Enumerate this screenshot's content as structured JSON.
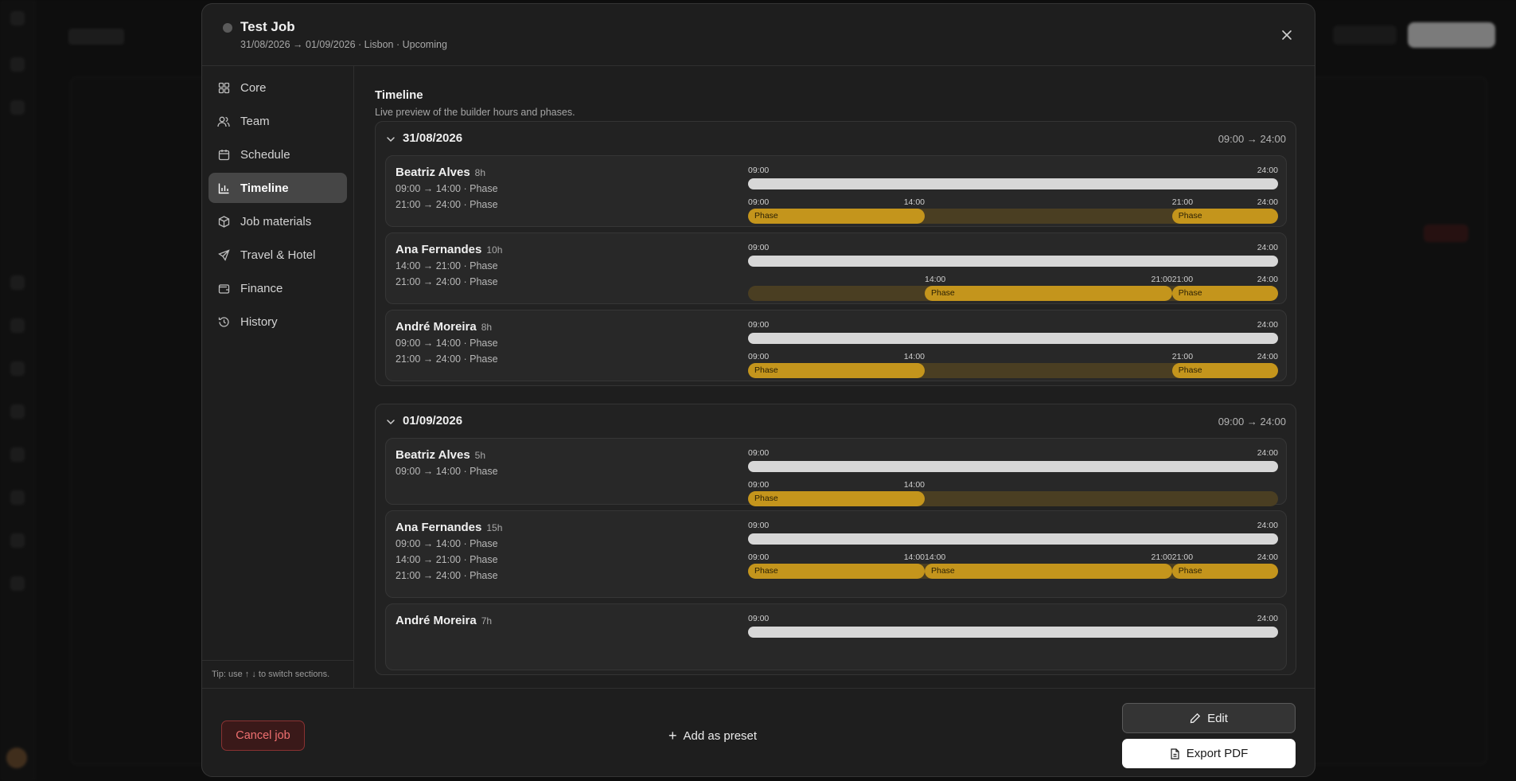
{
  "job": {
    "title": "Test Job",
    "subtitle": "31/08/2026 → 01/09/2026 · Lisbon · Upcoming"
  },
  "sidebar": {
    "items": [
      {
        "label": "Core",
        "icon": "grid-icon"
      },
      {
        "label": "Team",
        "icon": "users-icon"
      },
      {
        "label": "Schedule",
        "icon": "calendar-icon"
      },
      {
        "label": "Timeline",
        "icon": "bar-chart-icon",
        "active": true
      },
      {
        "label": "Job materials",
        "icon": "box-icon"
      },
      {
        "label": "Travel & Hotel",
        "icon": "plane-icon"
      },
      {
        "label": "Finance",
        "icon": "wallet-icon"
      },
      {
        "label": "History",
        "icon": "history-icon"
      }
    ],
    "tip": "Tip: use ↑ ↓ to switch sections."
  },
  "content": {
    "title": "Timeline",
    "subtitle": "Live preview of the builder hours and phases."
  },
  "days": [
    {
      "date": "31/08/2026",
      "range": "09:00 → 24:00",
      "people": [
        {
          "name": "Beatriz Alves",
          "hours": "8h",
          "lines": [
            "09:00 → 14:00 · Phase",
            "21:00 → 24:00 · Phase"
          ],
          "top_start": "09:00",
          "top_end": "24:00",
          "seg_ticks": [
            "09:00",
            "14:00",
            "21:00",
            "24:00"
          ],
          "segments": [
            {
              "label": "Phase",
              "start": "09:00",
              "end": "14:00"
            },
            {
              "label": "Phase",
              "start": "21:00",
              "end": "24:00"
            }
          ]
        },
        {
          "name": "Ana Fernandes",
          "hours": "10h",
          "lines": [
            "14:00 → 21:00 · Phase",
            "21:00 → 24:00 · Phase"
          ],
          "top_start": "09:00",
          "top_end": "24:00",
          "seg_ticks": [
            "14:00",
            "21:00",
            "21:00",
            "24:00"
          ],
          "segments": [
            {
              "label": "Phase",
              "start": "14:00",
              "end": "21:00"
            },
            {
              "label": "Phase",
              "start": "21:00",
              "end": "24:00"
            }
          ]
        },
        {
          "name": "André Moreira",
          "hours": "8h",
          "lines": [
            "09:00 → 14:00 · Phase",
            "21:00 → 24:00 · Phase"
          ],
          "top_start": "09:00",
          "top_end": "24:00",
          "seg_ticks": [
            "09:00",
            "14:00",
            "21:00",
            "24:00"
          ],
          "segments": [
            {
              "label": "Phase",
              "start": "09:00",
              "end": "14:00"
            },
            {
              "label": "Phase",
              "start": "21:00",
              "end": "24:00"
            }
          ]
        }
      ]
    },
    {
      "date": "01/09/2026",
      "range": "09:00 → 24:00",
      "people": [
        {
          "name": "Beatriz Alves",
          "hours": "5h",
          "lines": [
            "09:00 → 14:00 · Phase"
          ],
          "top_start": "09:00",
          "top_end": "24:00",
          "seg_ticks": [
            "09:00",
            "14:00"
          ],
          "segments": [
            {
              "label": "Phase",
              "start": "09:00",
              "end": "14:00"
            }
          ]
        },
        {
          "name": "Ana Fernandes",
          "hours": "15h",
          "lines": [
            "09:00 → 14:00 · Phase",
            "14:00 → 21:00 · Phase",
            "21:00 → 24:00 · Phase"
          ],
          "top_start": "09:00",
          "top_end": "24:00",
          "seg_ticks": [
            "09:00",
            "14:00",
            "14:00",
            "21:00",
            "21:00",
            "24:00"
          ],
          "segments": [
            {
              "label": "Phase",
              "start": "09:00",
              "end": "14:00"
            },
            {
              "label": "Phase",
              "start": "14:00",
              "end": "21:00"
            },
            {
              "label": "Phase",
              "start": "21:00",
              "end": "24:00"
            }
          ]
        },
        {
          "name": "André Moreira",
          "hours": "7h",
          "lines": [],
          "top_start": "09:00",
          "top_end": "24:00",
          "seg_ticks": [],
          "segments": []
        }
      ]
    }
  ],
  "footer": {
    "cancel": "Cancel job",
    "preset": "Add as preset",
    "edit": "Edit",
    "export": "Export PDF"
  },
  "colors": {
    "phase": "#c4951c",
    "phase_track": "#4a3e22",
    "cancel": "#f07070"
  }
}
